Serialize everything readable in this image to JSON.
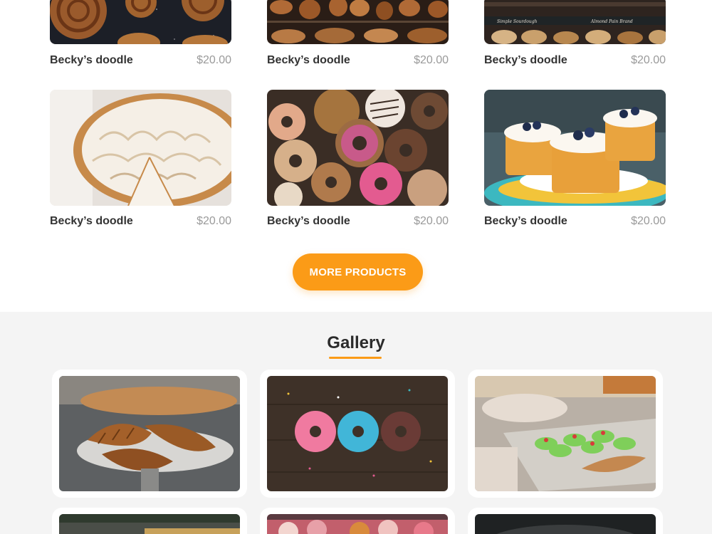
{
  "products": [
    {
      "name": "Becky’s doodle",
      "price": "$20.00",
      "image": "cinnamon-rolls-image"
    },
    {
      "name": "Becky’s doodle",
      "price": "$20.00",
      "image": "bread-shelf-image"
    },
    {
      "name": "Becky’s doodle",
      "price": "$20.00",
      "image": "bread-counter-image"
    },
    {
      "name": "Becky’s doodle",
      "price": "$20.00",
      "image": "meringue-pie-image"
    },
    {
      "name": "Becky’s doodle",
      "price": "$20.00",
      "image": "donuts-image"
    },
    {
      "name": "Becky’s doodle",
      "price": "$20.00",
      "image": "blueberry-cakes-image"
    }
  ],
  "more_button": {
    "label": "MORE PRODUCTS"
  },
  "gallery": {
    "title": "Gallery",
    "images": [
      "croissants-image",
      "three-donuts-image",
      "pastry-case-image",
      "display-case-image",
      "macarons-image",
      "dark-shelf-image"
    ]
  },
  "colors": {
    "accent": "#fb9b17",
    "gallery_bg": "#f4f4f4",
    "price": "#9a9a9a"
  }
}
